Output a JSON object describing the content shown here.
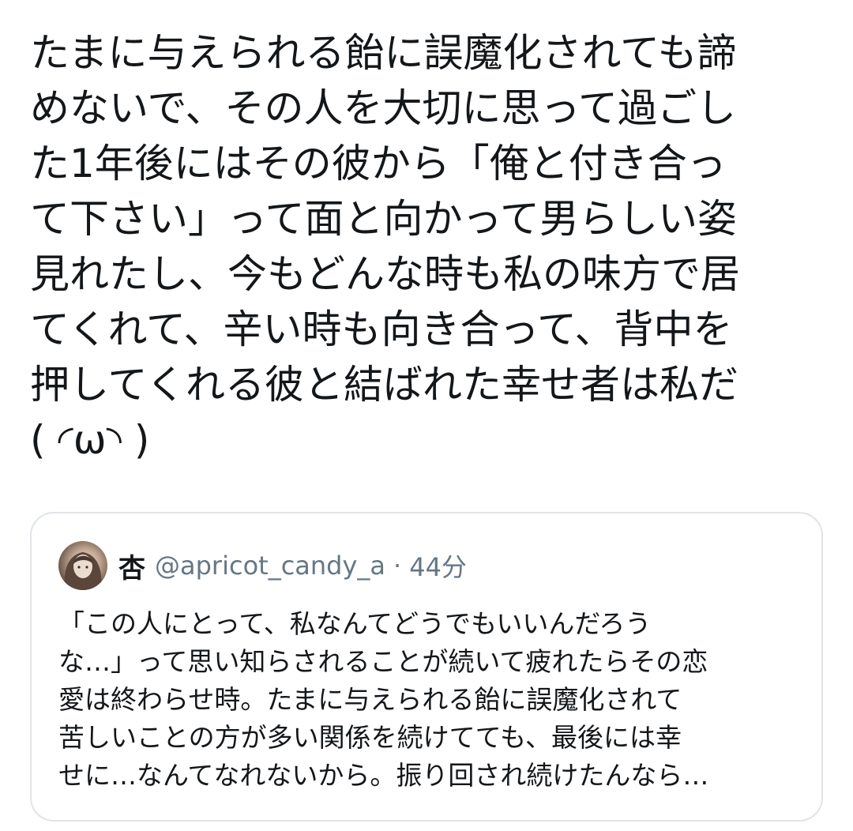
{
  "tweet": {
    "lines": [
      "たまに与えられる飴に誤魔化されても諦",
      "めないで、その人を大切に思って過ごし",
      "た1年後にはその彼から「俺と付き合っ",
      "て下さい」って面と向かって男らしい姿",
      "見れたし、今もどんな時も私の味方で居",
      "てくれて、辛い時も向き合って、背中を",
      "押してくれる彼と結ばれた幸せ者は私だ",
      "( ◜ω◝ )"
    ]
  },
  "quoted_tweet": {
    "name": "杏",
    "handle": "@apricot_candy_a",
    "separator": "·",
    "time": "44分",
    "avatar_icon": "user-avatar-icon",
    "lines": [
      "「この人にとって、私なんてどうでもいいんだろう",
      "な…」って思い知らされることが続いて疲れたらその恋",
      "愛は終わらせ時。たまに与えられる飴に誤魔化されて",
      "苦しいことの方が多い関係を続けてても、最後には幸",
      "せに…なんてなれないから。振り回され続けたんなら…"
    ]
  },
  "colors": {
    "text": "#14171a",
    "secondary_text": "#657786",
    "card_border": "#dfe4e8",
    "background": "#ffffff"
  }
}
